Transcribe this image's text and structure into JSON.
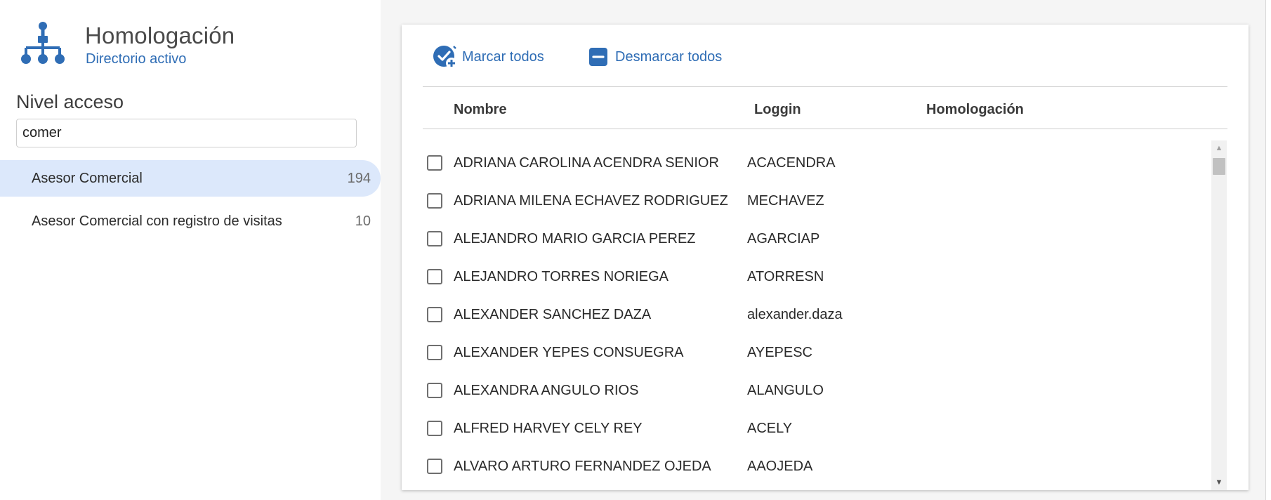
{
  "header": {
    "title": "Homologación",
    "subtitle": "Directorio activo",
    "icon": "org-chart-icon"
  },
  "access": {
    "section_title": "Nivel acceso",
    "filter_value": "comer",
    "roles": [
      {
        "label": "Asesor Comercial",
        "count": "194",
        "active": true
      },
      {
        "label": "Asesor Comercial con registro de visitas",
        "count": "10",
        "active": false
      }
    ]
  },
  "toolbar": {
    "mark_all": "Marcar todos",
    "unmark_all": "Desmarcar todos"
  },
  "table": {
    "columns": [
      "Nombre",
      "Loggin",
      "Homologación"
    ],
    "rows": [
      {
        "name": "ADRIANA CAROLINA ACENDRA SENIOR",
        "login": "ACACENDRA",
        "homologacion": ""
      },
      {
        "name": "ADRIANA MILENA ECHAVEZ RODRIGUEZ",
        "login": "MECHAVEZ",
        "homologacion": ""
      },
      {
        "name": "ALEJANDRO MARIO GARCIA PEREZ",
        "login": "AGARCIAP",
        "homologacion": ""
      },
      {
        "name": "ALEJANDRO TORRES NORIEGA",
        "login": "ATORRESN",
        "homologacion": ""
      },
      {
        "name": "ALEXANDER SANCHEZ DAZA",
        "login": "alexander.daza",
        "homologacion": ""
      },
      {
        "name": "ALEXANDER YEPES CONSUEGRA",
        "login": "AYEPESC",
        "homologacion": ""
      },
      {
        "name": "ALEXANDRA ANGULO RIOS",
        "login": "ALANGULO",
        "homologacion": ""
      },
      {
        "name": "ALFRED HARVEY CELY REY",
        "login": "ACELY",
        "homologacion": ""
      },
      {
        "name": "ALVARO ARTURO FERNANDEZ OJEDA",
        "login": "AAOJEDA",
        "homologacion": ""
      }
    ]
  },
  "colors": {
    "accent": "#2f6db5",
    "selected_bg": "#dce8fb",
    "panel_bg": "#f5f5f5"
  }
}
